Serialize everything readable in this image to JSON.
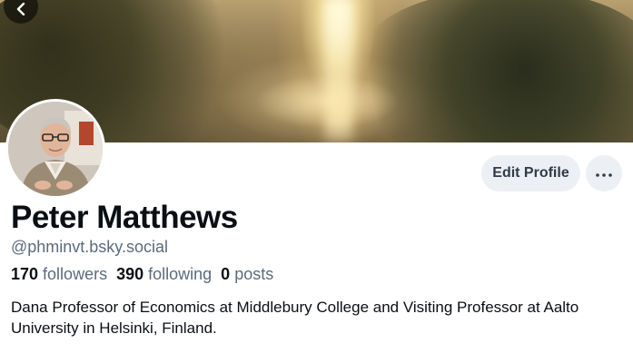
{
  "profile": {
    "display_name": "Peter Matthews",
    "handle": "@phminvt.bsky.social",
    "followers_count": "170",
    "followers_label": "followers",
    "following_count": "390",
    "following_label": "following",
    "posts_count": "0",
    "posts_label": "posts",
    "bio": "Dana Professor of Economics at Middlebury College and Visiting Professor at Aalto University in Helsinki, Finland."
  },
  "actions": {
    "edit_profile_label": "Edit Profile",
    "more_icon": "ellipsis-icon",
    "back_icon": "chevron-left-icon"
  },
  "colors": {
    "button_bg": "#ecf0f4",
    "secondary_text": "#5b6b7d",
    "primary_text": "#0b0f14"
  }
}
